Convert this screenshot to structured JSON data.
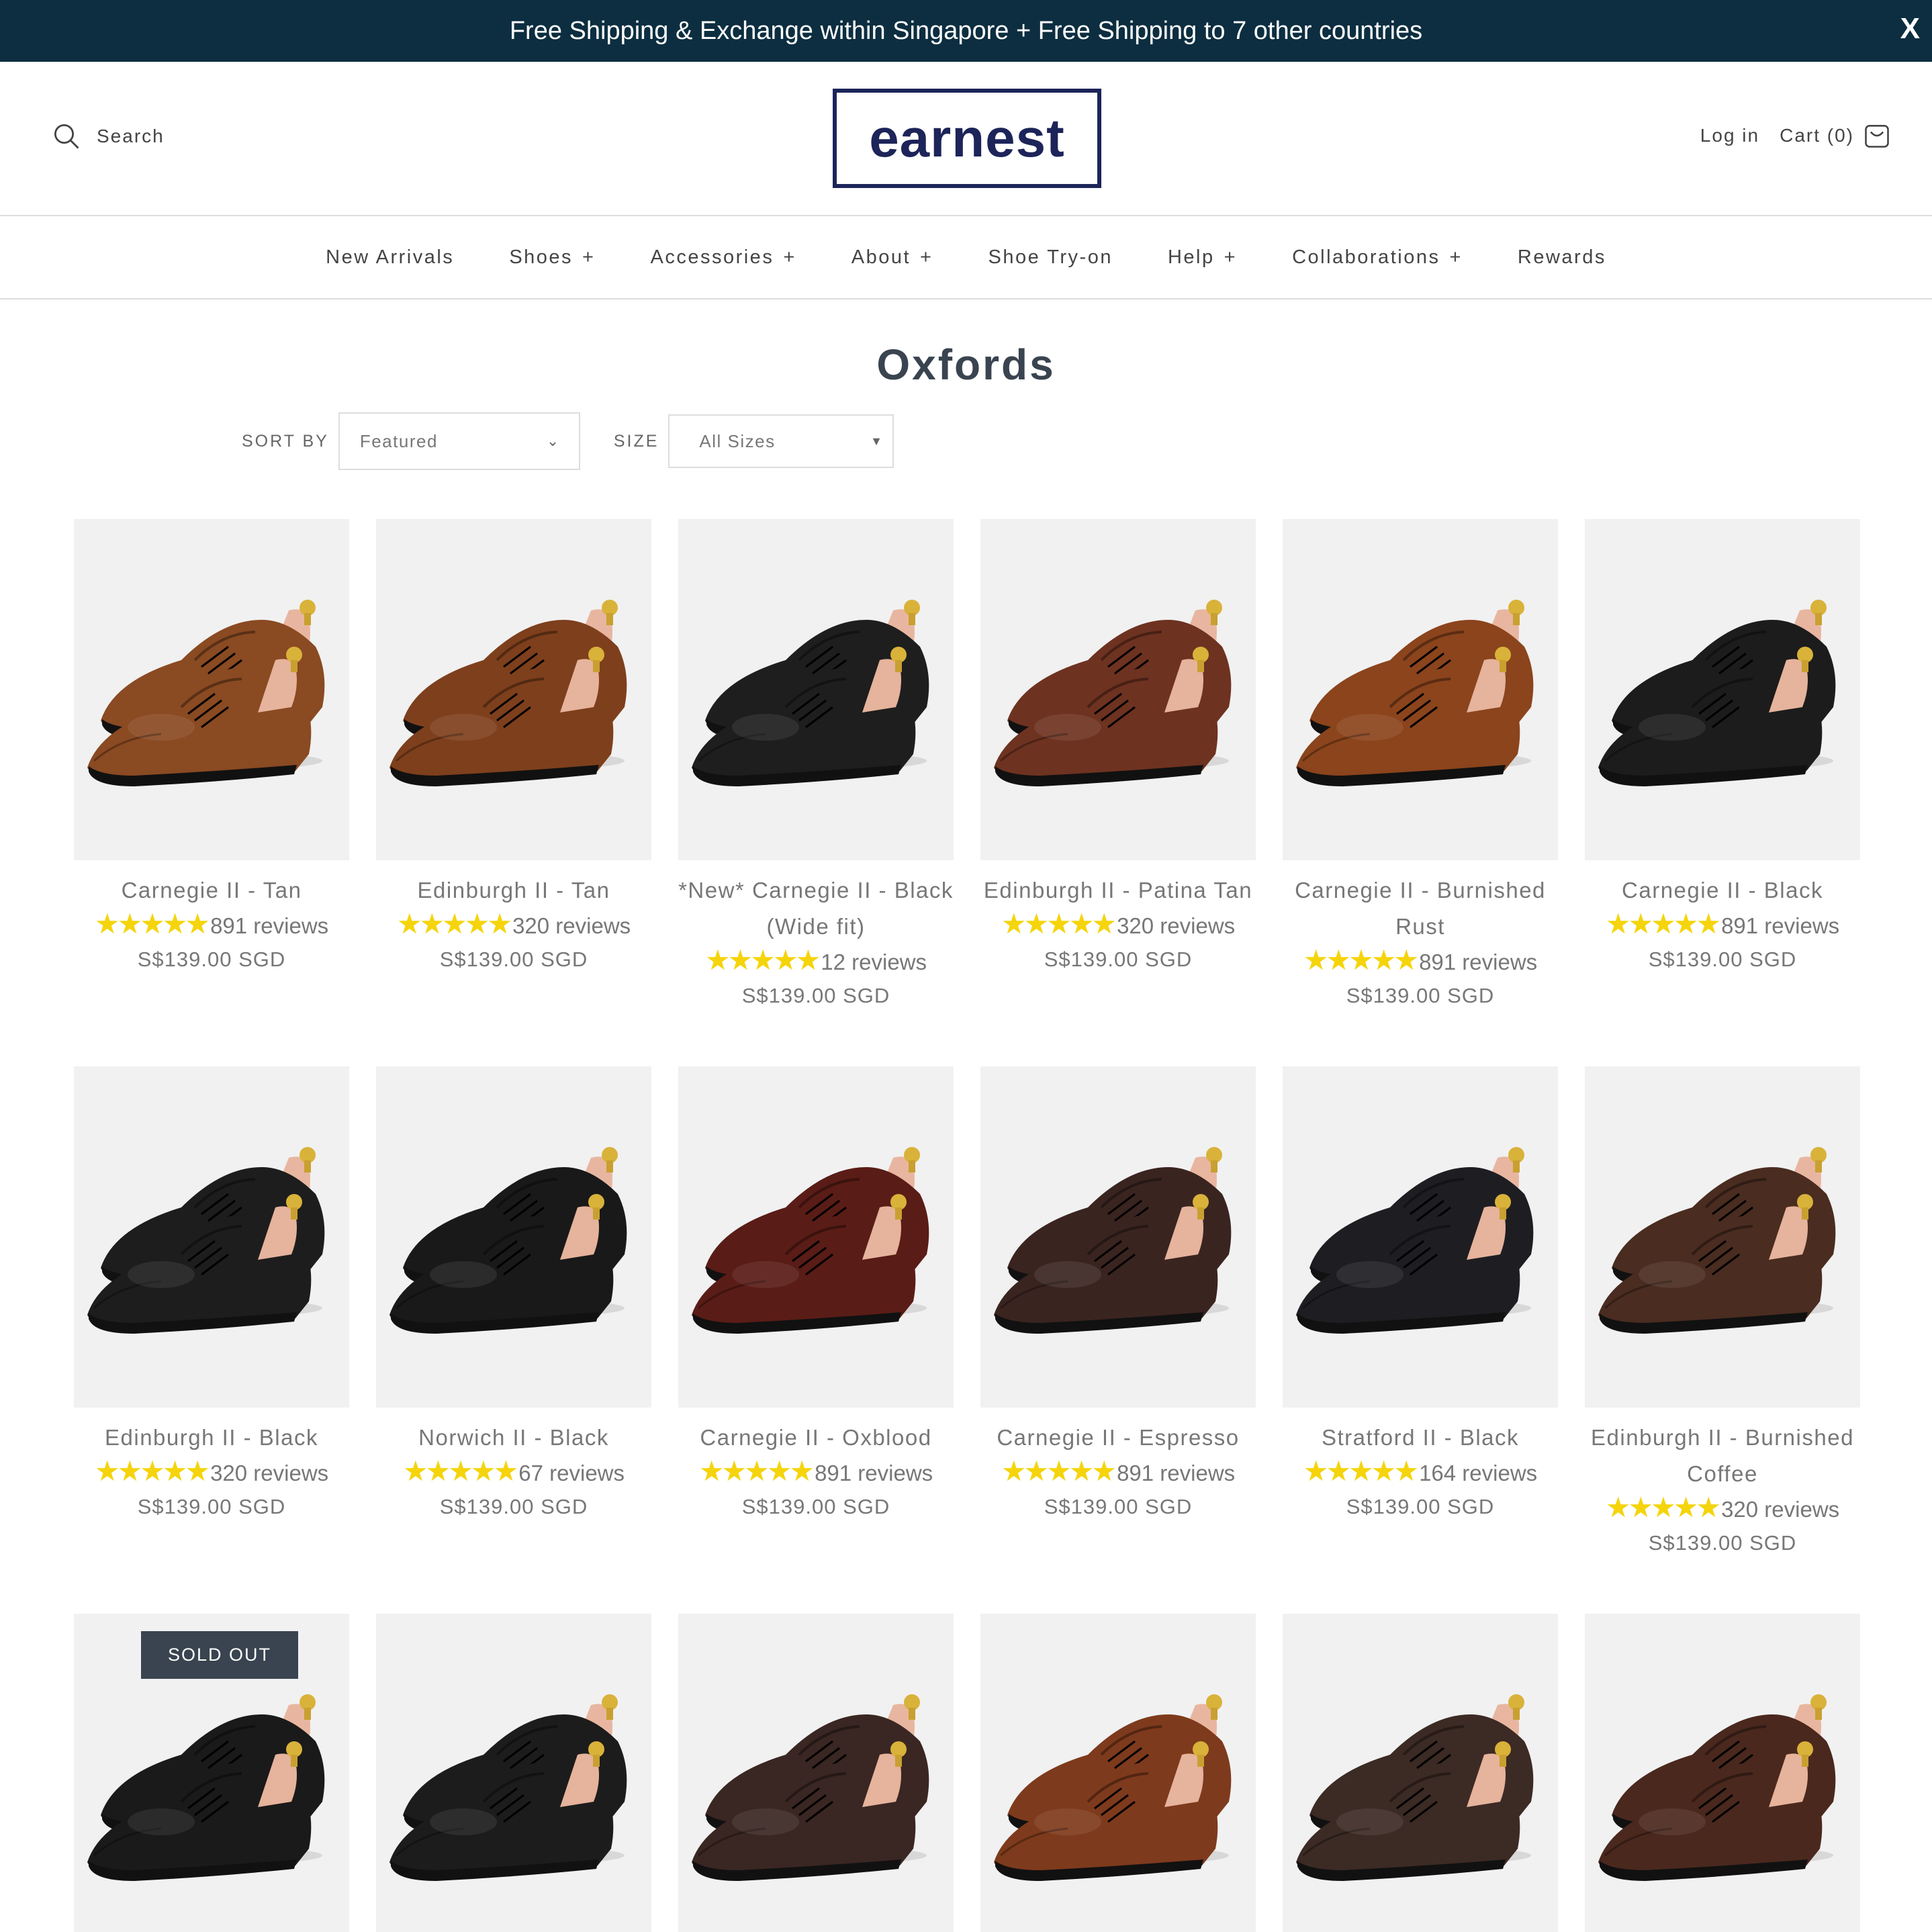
{
  "announcement": {
    "text": "Free Shipping & Exchange within Singapore + Free Shipping to 7 other countries",
    "close": "X"
  },
  "header": {
    "search_label": "Search",
    "logo": "earnest",
    "login": "Log in",
    "cart": "Cart (0)"
  },
  "nav": [
    {
      "label": "New Arrivals",
      "plus": ""
    },
    {
      "label": "Shoes",
      "plus": "+"
    },
    {
      "label": "Accessories",
      "plus": "+"
    },
    {
      "label": "About",
      "plus": "+"
    },
    {
      "label": "Shoe Try-on",
      "plus": ""
    },
    {
      "label": "Help",
      "plus": "+"
    },
    {
      "label": "Collaborations",
      "plus": "+"
    },
    {
      "label": "Rewards",
      "plus": ""
    }
  ],
  "page_title": "Oxfords",
  "filters": {
    "sort_label": "SORT BY",
    "sort_value": "Featured",
    "size_label": "SIZE",
    "size_value": "All Sizes"
  },
  "colors": {
    "announcement_bg": "#0c2e40",
    "logo": "#1c2459",
    "stars": "#f5d40b",
    "sold_out_bg": "#3a4450"
  },
  "products": [
    {
      "name": "Carnegie II - Tan",
      "stars": "★★★★★",
      "reviews": "891 reviews",
      "price": "S$139.00 SGD",
      "color": "#8a4a22",
      "sold_out": ""
    },
    {
      "name": "Edinburgh II - Tan",
      "stars": "★★★★★",
      "reviews": "320 reviews",
      "price": "S$139.00 SGD",
      "color": "#7e3f1c",
      "sold_out": ""
    },
    {
      "name": "*New* Carnegie II - Black (Wide fit)",
      "stars": "★★★★★",
      "reviews": "12 reviews",
      "price": "S$139.00 SGD",
      "color": "#1e1e1e",
      "sold_out": ""
    },
    {
      "name": "Edinburgh II - Patina Tan",
      "stars": "★★★★★",
      "reviews": "320 reviews",
      "price": "S$139.00 SGD",
      "color": "#6e3220",
      "sold_out": ""
    },
    {
      "name": "Carnegie II - Burnished Rust",
      "stars": "★★★★★",
      "reviews": "891 reviews",
      "price": "S$139.00 SGD",
      "color": "#8b441c",
      "sold_out": ""
    },
    {
      "name": "Carnegie II - Black",
      "stars": "★★★★★",
      "reviews": "891 reviews",
      "price": "S$139.00 SGD",
      "color": "#1c1c1c",
      "sold_out": ""
    },
    {
      "name": "Edinburgh II - Black",
      "stars": "★★★★★",
      "reviews": "320 reviews",
      "price": "S$139.00 SGD",
      "color": "#1d1d1d",
      "sold_out": ""
    },
    {
      "name": "Norwich II - Black",
      "stars": "★★★★★",
      "reviews": "67 reviews",
      "price": "S$139.00 SGD",
      "color": "#191919",
      "sold_out": ""
    },
    {
      "name": "Carnegie II - Oxblood",
      "stars": "★★★★★",
      "reviews": "891 reviews",
      "price": "S$139.00 SGD",
      "color": "#5a1c16",
      "sold_out": ""
    },
    {
      "name": "Carnegie II - Espresso",
      "stars": "★★★★★",
      "reviews": "891 reviews",
      "price": "S$139.00 SGD",
      "color": "#3a2420",
      "sold_out": ""
    },
    {
      "name": "Stratford II - Black",
      "stars": "★★★★★",
      "reviews": "164 reviews",
      "price": "S$139.00 SGD",
      "color": "#1e1e22",
      "sold_out": ""
    },
    {
      "name": "Edinburgh II - Burnished Coffee",
      "stars": "★★★★★",
      "reviews": "320 reviews",
      "price": "S$139.00 SGD",
      "color": "#4a2c20",
      "sold_out": ""
    },
    {
      "name": "",
      "stars": "",
      "reviews": "",
      "price": "",
      "color": "#1a1a1a",
      "sold_out": "SOLD OUT"
    },
    {
      "name": "",
      "stars": "",
      "reviews": "",
      "price": "",
      "color": "#1c1c1c",
      "sold_out": ""
    },
    {
      "name": "",
      "stars": "",
      "reviews": "",
      "price": "",
      "color": "#3a2622",
      "sold_out": ""
    },
    {
      "name": "",
      "stars": "",
      "reviews": "",
      "price": "",
      "color": "#7e3a1c",
      "sold_out": ""
    },
    {
      "name": "",
      "stars": "",
      "reviews": "",
      "price": "",
      "color": "#3c2a24",
      "sold_out": ""
    },
    {
      "name": "",
      "stars": "",
      "reviews": "",
      "price": "",
      "color": "#4a281e",
      "sold_out": ""
    }
  ]
}
